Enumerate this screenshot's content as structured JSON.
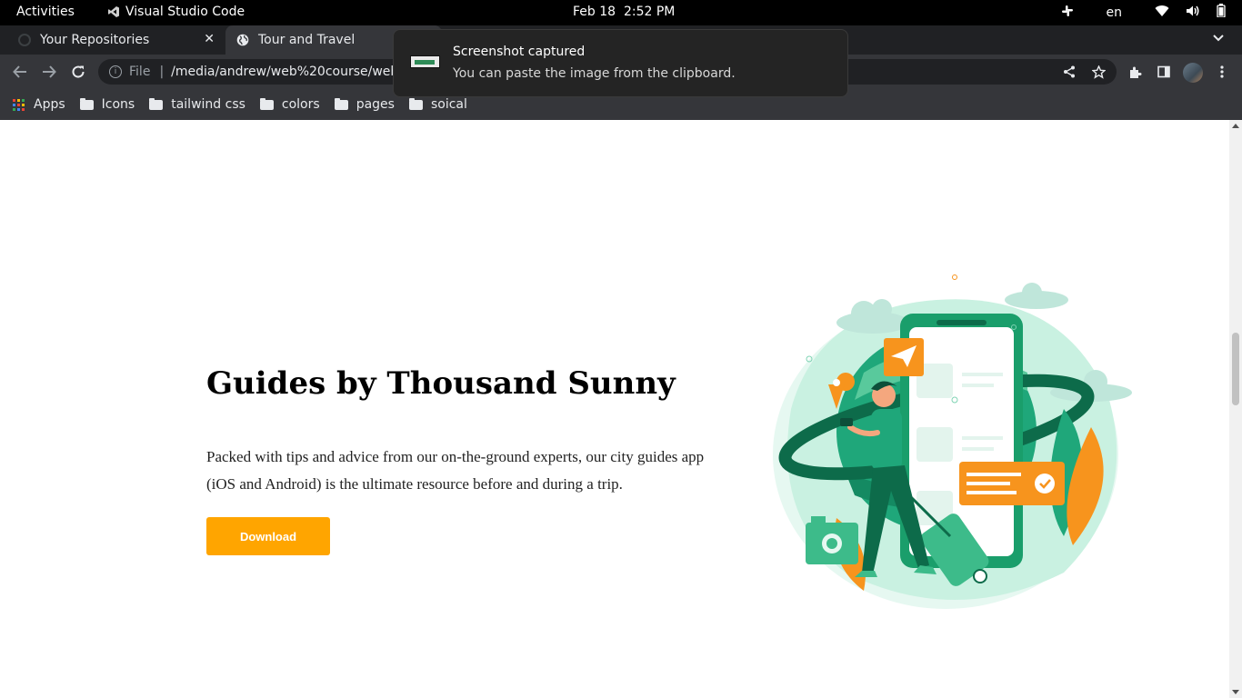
{
  "topbar": {
    "activities": "Activities",
    "app_name": "Visual Studio Code",
    "date": "Feb 18",
    "time": "2:52 PM",
    "language": "en"
  },
  "tabs": [
    {
      "title": "Your Repositories",
      "active": false
    },
    {
      "title": "Tour and Travel",
      "active": true
    }
  ],
  "toolbar": {
    "scheme_label": "File",
    "url": "/media/andrew/web%20course/web/Pr"
  },
  "bookmarks": [
    {
      "label": "Apps",
      "icon": "apps-grid-icon"
    },
    {
      "label": "Icons",
      "icon": "folder-icon"
    },
    {
      "label": "tailwind css",
      "icon": "folder-icon"
    },
    {
      "label": "colors",
      "icon": "folder-icon"
    },
    {
      "label": "pages",
      "icon": "folder-icon"
    },
    {
      "label": "soical",
      "icon": "folder-icon"
    }
  ],
  "notification": {
    "title": "Screenshot captured",
    "body": "You can paste the image from the clipboard."
  },
  "hero": {
    "title": "Guides by Thousand Sunny",
    "text": "Packed with tips and advice from our on-the-ground experts, our city guides app (iOS and Android) is the ultimate resource before and during a trip.",
    "button_label": "Download"
  },
  "colors": {
    "accent": "#ffa500",
    "illustration_green": "#1a9e6b",
    "illustration_orange": "#f7941d",
    "chrome_dark": "#202124",
    "chrome_toolbar": "#35363a"
  }
}
